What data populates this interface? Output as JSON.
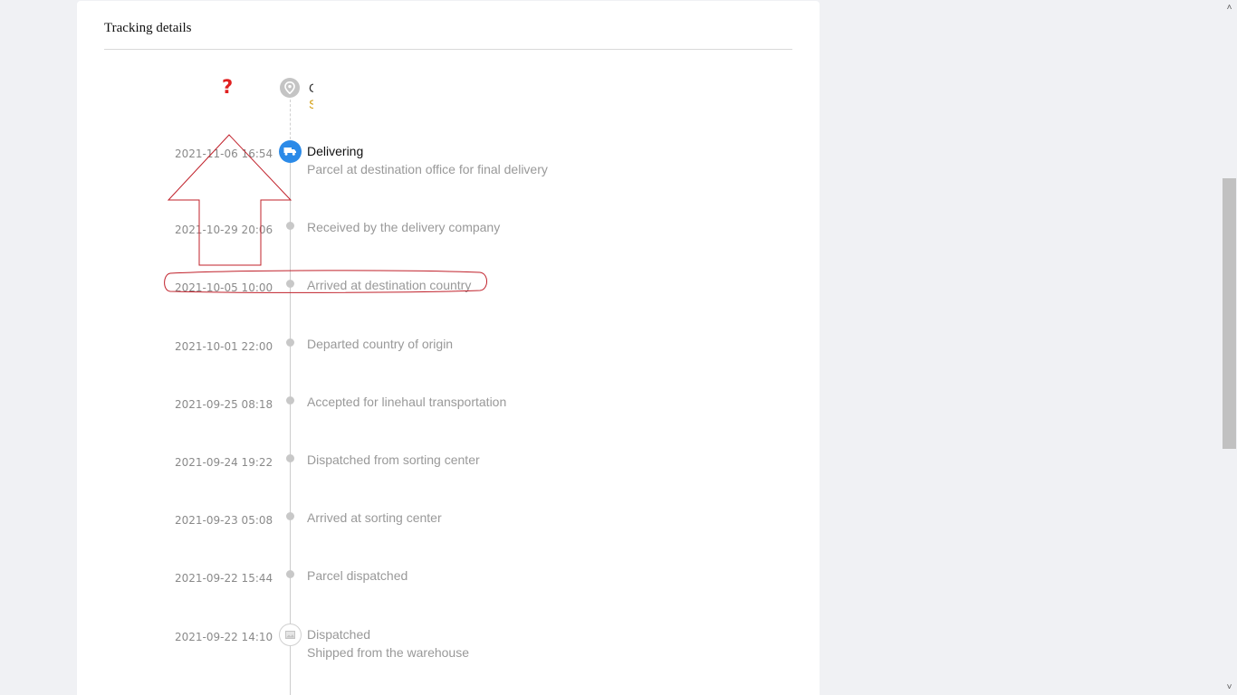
{
  "card": {
    "title": "Tracking details"
  },
  "origin": {
    "line1": "C",
    "line2": "S",
    "icon": "location-pin-icon"
  },
  "annotation": {
    "question_mark": "?",
    "arrow_color": "#c0202a",
    "circle_color": "#c0202a"
  },
  "events": [
    {
      "time": "2021-11-06 16:54",
      "status": "Delivering",
      "detail": "Parcel at destination office for final delivery",
      "icon": "delivery-truck-icon",
      "active": true
    },
    {
      "time": "2021-10-29 20:06",
      "status": "Received by the delivery company"
    },
    {
      "time": "2021-10-05 10:00",
      "status": "Arrived at destination country"
    },
    {
      "time": "2021-10-01 22:00",
      "status": "Departed country of origin"
    },
    {
      "time": "2021-09-25 08:18",
      "status": "Accepted for linehaul transportation"
    },
    {
      "time": "2021-09-24 19:22",
      "status": "Dispatched from sorting center"
    },
    {
      "time": "2021-09-23 05:08",
      "status": "Arrived at sorting center"
    },
    {
      "time": "2021-09-22 15:44",
      "status": "Parcel dispatched"
    },
    {
      "time": "2021-09-22 14:10",
      "status": "Dispatched",
      "detail": "Shipped from the warehouse",
      "icon": "package-box-icon"
    }
  ],
  "colors": {
    "accent": "#2b8ae8",
    "muted_text": "#999999",
    "background": "#f0f1f4"
  },
  "scrollbar": {
    "up_icon": "scroll-up-arrow-icon",
    "down_icon": "scroll-down-arrow-icon"
  }
}
